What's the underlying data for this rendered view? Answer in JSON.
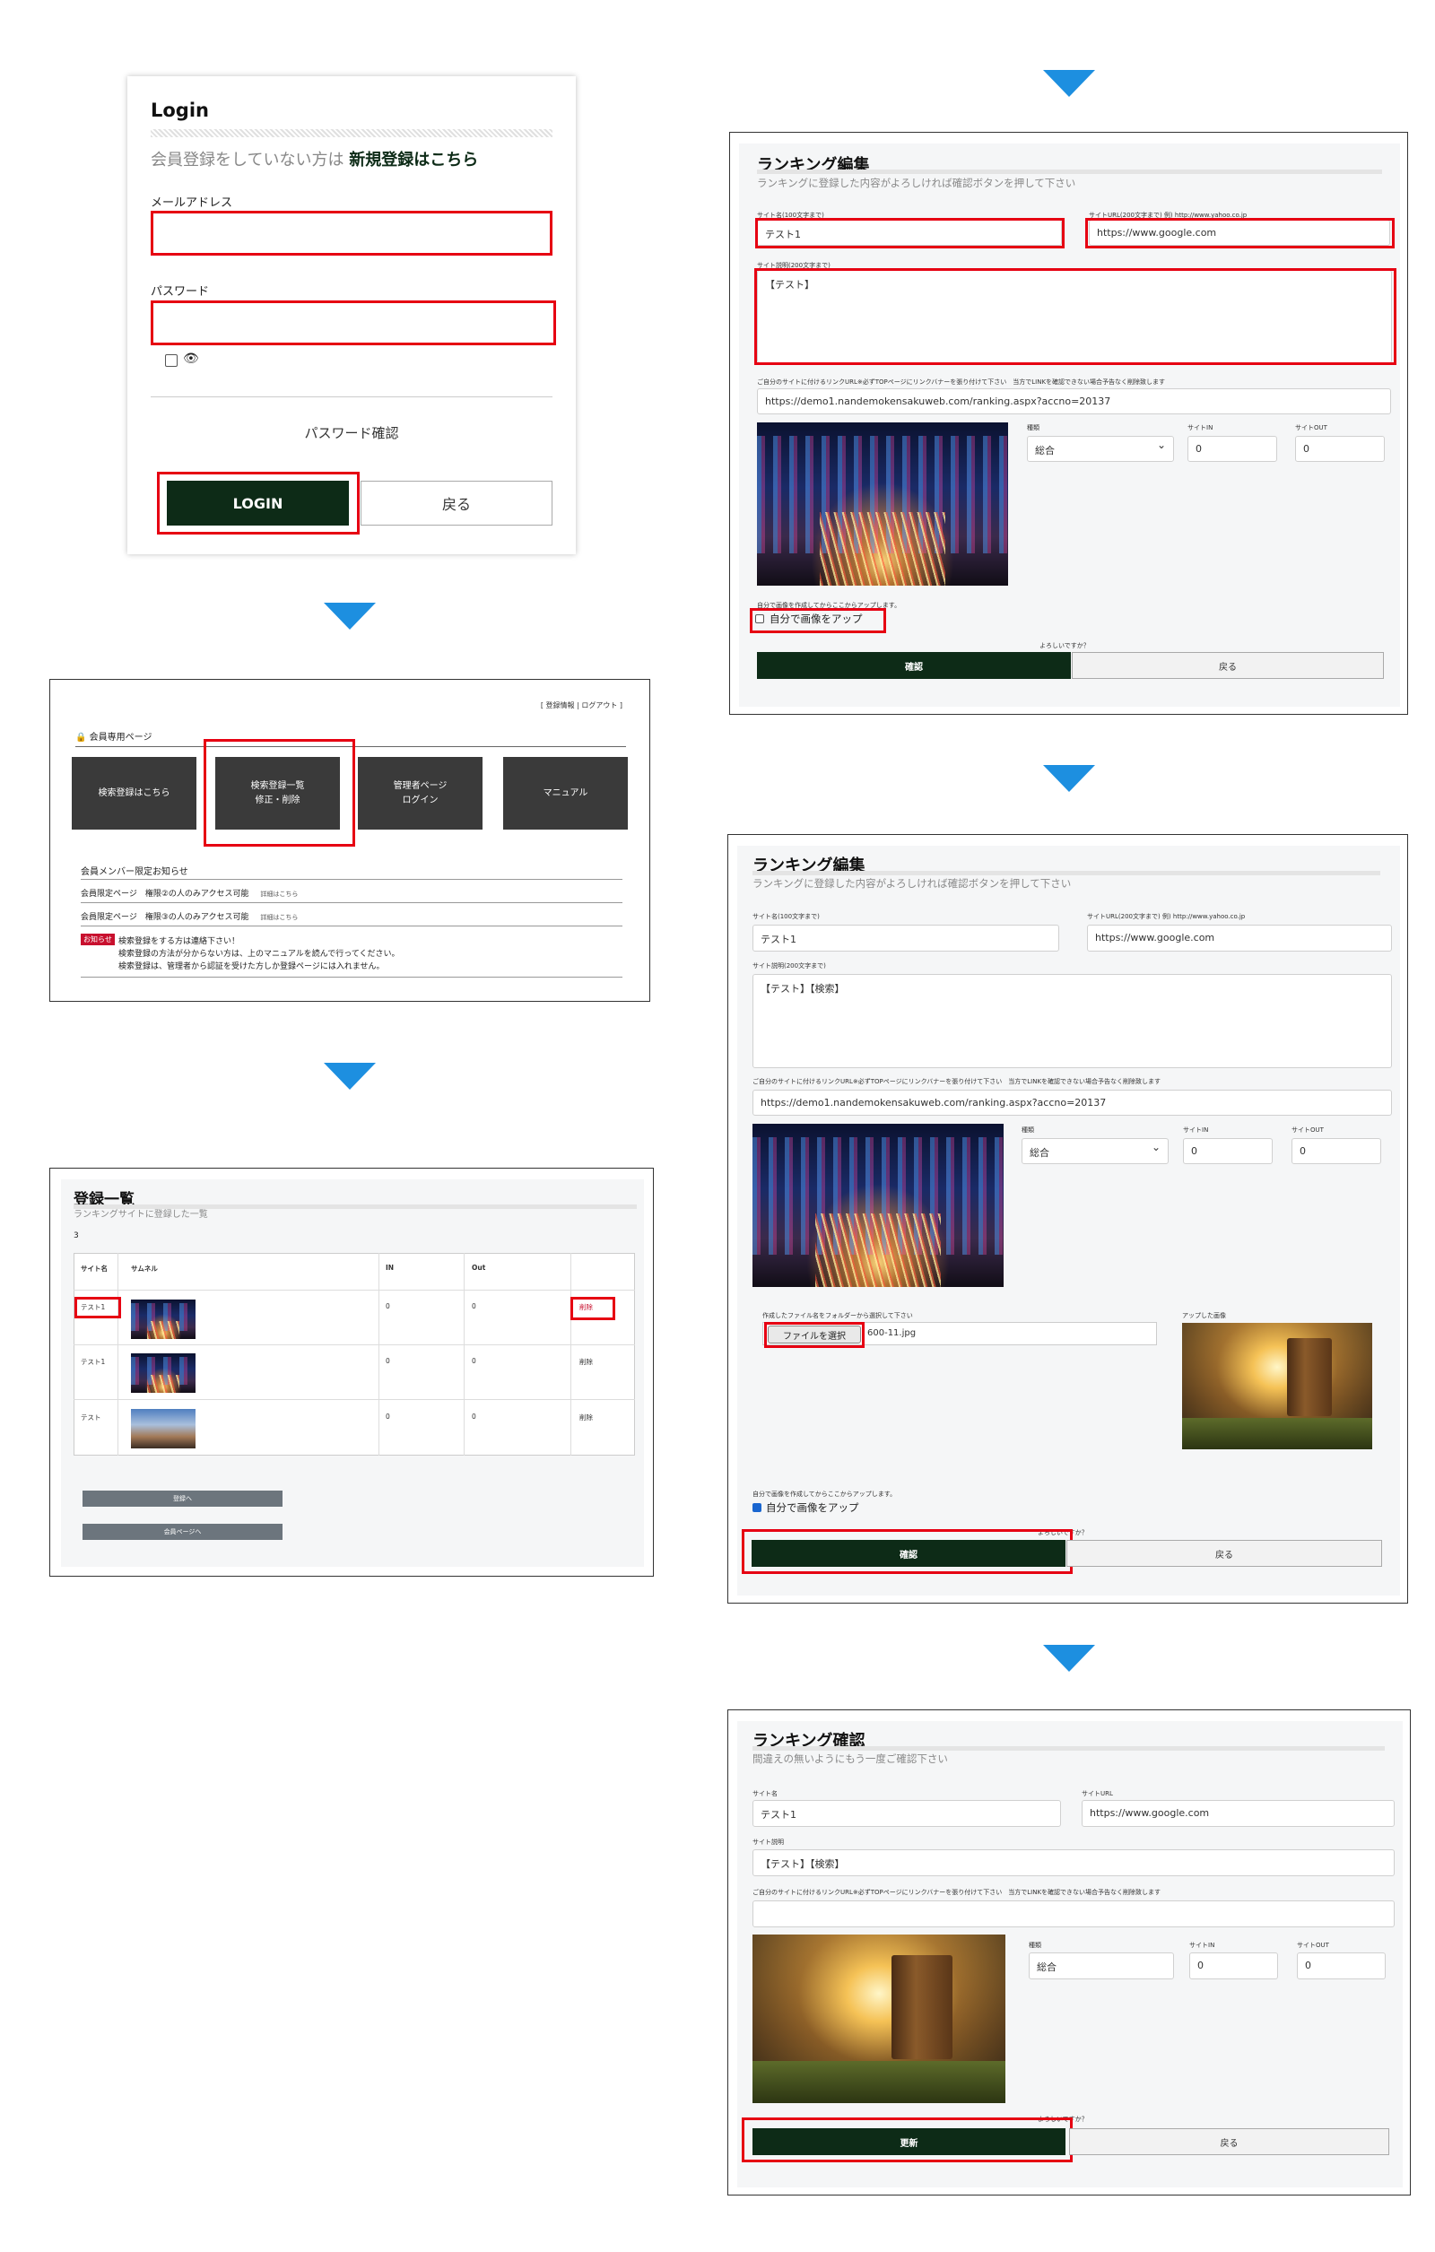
{
  "login": {
    "title": "Login",
    "signup_prompt": "会員登録をしていない方は",
    "signup_link": "新規登録はこちら",
    "email_label": "メールアドレス",
    "password_label": "パスワード",
    "password_check": "パスワード確認",
    "login_button": "LOGIN",
    "back_button": "戻る"
  },
  "member": {
    "top_links": "[ 登録情報 | ログアウト ]",
    "page_heading": "会員専用ページ",
    "tiles": [
      "検索登録はこちら",
      "検索登録一覧\n修正・削除",
      "管理者ページ\nログイン",
      "マニュアル"
    ],
    "notice_heading": "会員メンバー限定お知らせ",
    "notices": [
      {
        "text": "会員限定ページ　権限②の人のみアクセス可能",
        "link": "詳細はこちら"
      },
      {
        "text": "会員限定ページ　権限③の人のみアクセス可能",
        "link": "詳細はこちら"
      }
    ],
    "badge": "お知らせ",
    "message_lines": [
      "検索登録をする方は連絡下さい！",
      "検索登録の方法が分からない方は、上のマニュアルを読んで行ってください。",
      "検索登録は、管理者から認証を受けた方しか登録ページには入れません。"
    ]
  },
  "list": {
    "title": "登録一覧",
    "subtitle": "ランキングサイトに登録した一覧",
    "count": "3",
    "headers": [
      "サイト名",
      "サムネル",
      "IN",
      "Out",
      ""
    ],
    "rows": [
      {
        "name": "テスト1",
        "in": "0",
        "out": "0",
        "action": "削除"
      },
      {
        "name": "テスト1",
        "in": "0",
        "out": "0",
        "action": "削除"
      },
      {
        "name": "テスト",
        "in": "0",
        "out": "0",
        "action": "削除"
      }
    ],
    "register_button": "登録へ",
    "member_button": "会員ページへ"
  },
  "edit1": {
    "title": "ランキング編集",
    "subtitle": "ランキングに登録した内容がよろしければ確認ボタンを押して下さい",
    "site_name_label": "サイト名(100文字まで)",
    "site_name_value": "テスト1",
    "site_url_label": "サイトURL(200文字まで) 例) http://www.yahoo.co.jp",
    "site_url_value": "https://www.google.com",
    "desc_label": "サイト説明(200文字まで)",
    "desc_value": "【テスト】",
    "link_note": "ご自分のサイトに付けるリンクURL※必ずTOPページにリンクバナーを張り付けて下さい　当方でLINKを確認できない場合予告なく削除致します",
    "link_url": "https://demo1.nandemokensakuweb.com/ranking.aspx?accno=20137",
    "type_label": "種類",
    "type_value": "総合",
    "in_label": "サイトIN",
    "in_value": "0",
    "out_label": "サイトOUT",
    "out_value": "0",
    "upload_note": "自分で画像を作成してからここからアップします。",
    "upload_check": "自分で画像をアップ",
    "confirm_prompt": "よろしいですか？",
    "confirm_button": "確認",
    "back_button": "戻る"
  },
  "edit2": {
    "title": "ランキング編集",
    "subtitle": "ランキングに登録した内容がよろしければ確認ボタンを押して下さい",
    "site_name_label": "サイト名(100文字まで)",
    "site_name_value": "テスト1",
    "site_url_label": "サイトURL(200文字まで) 例) http://www.yahoo.co.jp",
    "site_url_value": "https://www.google.com",
    "desc_label": "サイト説明(200文字まで)",
    "desc_value": "【テスト】【検索】",
    "link_note": "ご自分のサイトに付けるリンクURL※必ずTOPページにリンクバナーを張り付けて下さい　当方でLINKを確認できない場合予告なく削除致します",
    "link_url": "https://demo1.nandemokensakuweb.com/ranking.aspx?accno=20137",
    "type_label": "種類",
    "type_value": "総合",
    "in_label": "サイトIN",
    "in_value": "0",
    "out_label": "サイトOUT",
    "out_value": "0",
    "file_label": "作成したファイル名をフォルダーから選択して下さい",
    "file_button": "ファイルを選択",
    "file_name": "600-11.jpg",
    "uploaded_label": "アップした画像",
    "upload_note": "自分で画像を作成してからここからアップします。",
    "upload_check": "自分で画像をアップ",
    "confirm_prompt": "よろしいですか？",
    "confirm_button": "確認",
    "back_button": "戻る"
  },
  "confirm": {
    "title": "ランキング確認",
    "subtitle": "間違えの無いようにもう一度ご確認下さい",
    "site_name_label": "サイト名",
    "site_name_value": "テスト1",
    "site_url_label": "サイトURL",
    "site_url_value": "https://www.google.com",
    "desc_label": "サイト説明",
    "desc_value": "【テスト】【検索】",
    "link_note": "ご自分のサイトに付けるリンクURL※必ずTOPページにリンクバナーを張り付けて下さい　当方でLINKを確認できない場合予告なく削除致します",
    "type_label": "種類",
    "type_value": "総合",
    "in_label": "サイトIN",
    "in_value": "0",
    "out_label": "サイトOUT",
    "out_value": "0",
    "confirm_prompt": "よろしいですか？",
    "update_button": "更新",
    "back_button": "戻る"
  },
  "colors": {
    "arrow": "#1d8fe0",
    "highlight": "#e60012",
    "primary_button": "#0d2b17"
  }
}
